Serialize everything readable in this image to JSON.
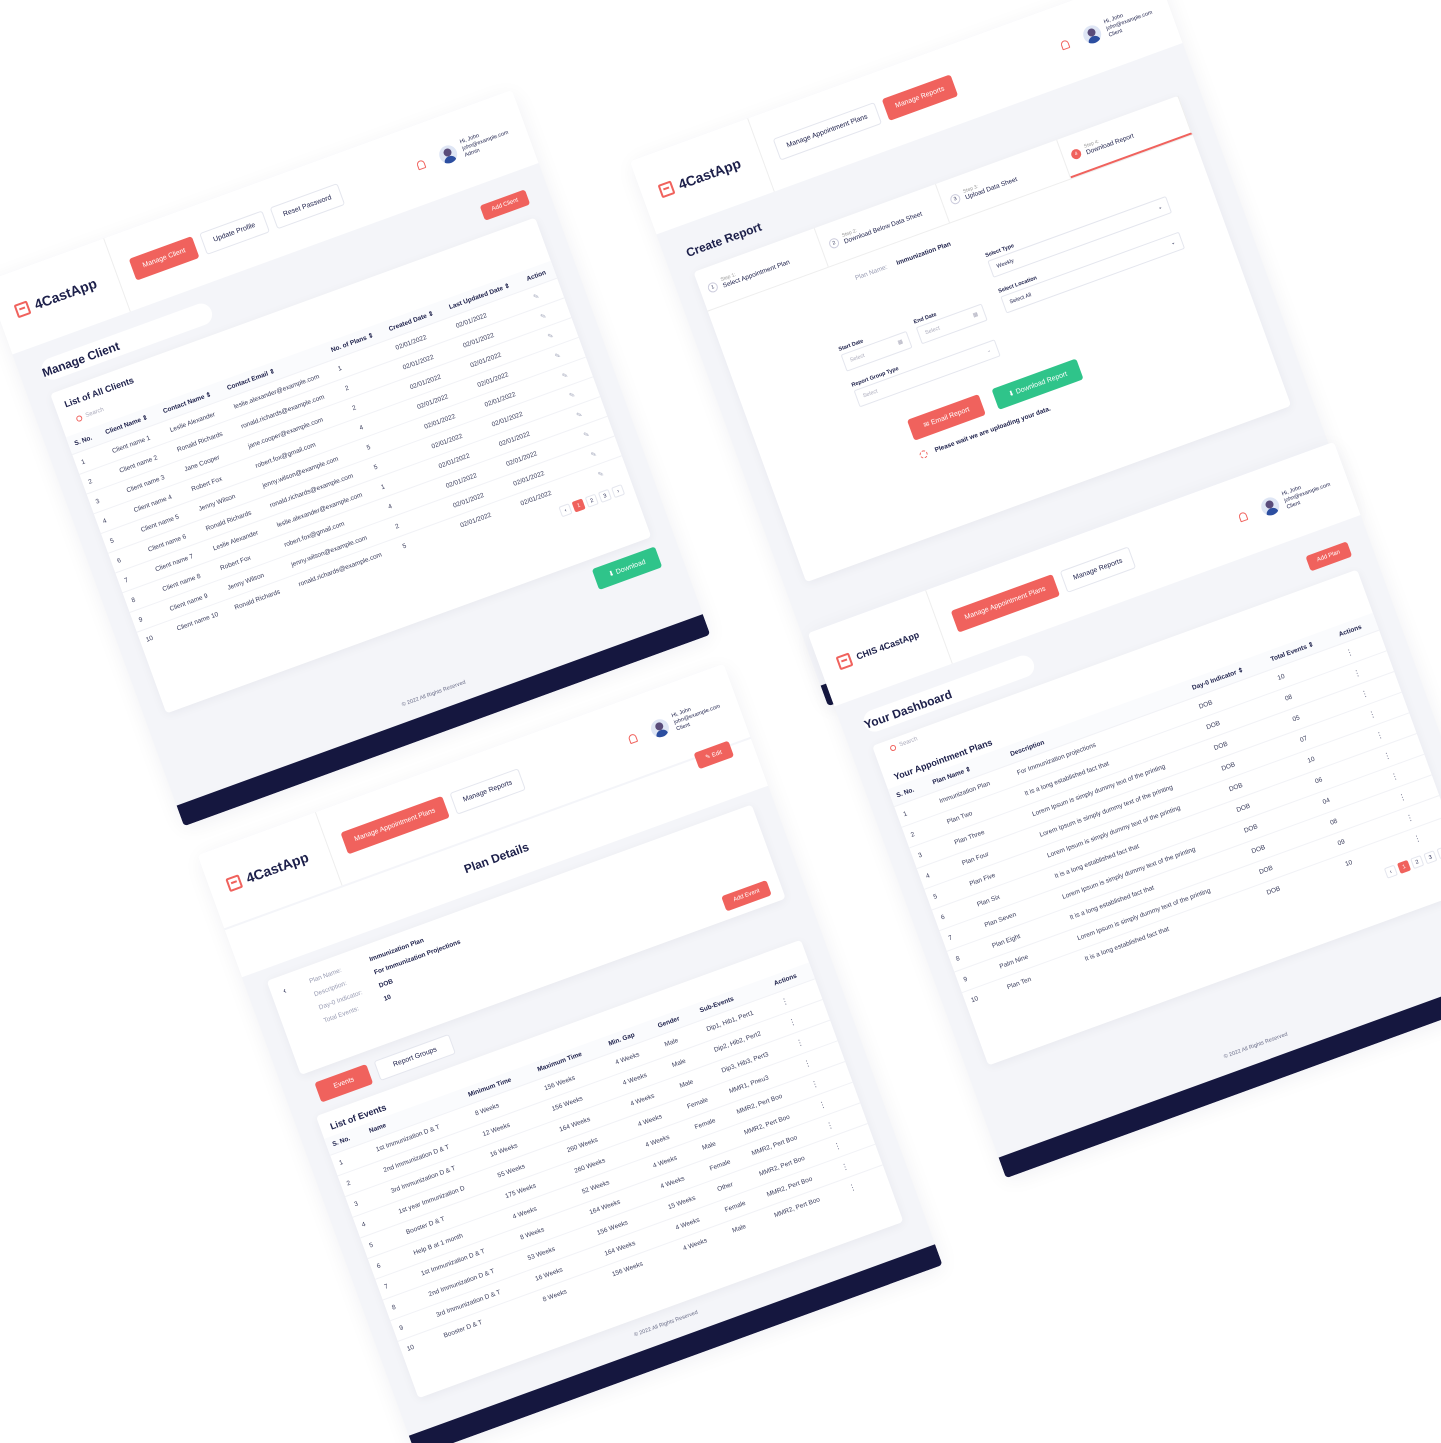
{
  "brand": {
    "name": "4CastApp",
    "alt_name": "CHIS 4CastApp",
    "accent": "#f0625d",
    "green": "#2fc48a",
    "navy": "#15173f"
  },
  "footer": {
    "copyright": "© 2022 All Rights Reserved"
  },
  "manage_client": {
    "nav": [
      "Manage Client",
      "Update Profile",
      "Reset Password"
    ],
    "user": {
      "greeting": "Hi, John",
      "email": "john@example.com",
      "role": "Admin"
    },
    "title": "Manage Client",
    "add_button": "Add Client",
    "card_title": "List of All Clients",
    "search_placeholder": "Search",
    "columns": [
      "S. No.",
      "Client Name ⇕",
      "Contact Name ⇕",
      "Contact Email ⇕",
      "No. of Plans ⇕",
      "Created Date ⇕",
      "Last Updated Date ⇕",
      "Action"
    ],
    "rows": [
      [
        "1",
        "Client name 1",
        "Leslie Alexander",
        "leslie.alexander@example.com",
        "1",
        "02/01/2022",
        "02/01/2022"
      ],
      [
        "2",
        "Client name 2",
        "Ronald Richards",
        "ronald.richards@example.com",
        "2",
        "02/01/2022",
        "02/01/2022"
      ],
      [
        "3",
        "Client name 3",
        "Jane Cooper",
        "jane.cooper@example.com",
        "2",
        "02/01/2022",
        "02/01/2022"
      ],
      [
        "4",
        "Client name 4",
        "Robert Fox",
        "robert.fox@gmail.com",
        "4",
        "02/01/2022",
        "02/01/2022"
      ],
      [
        "5",
        "Client name 5",
        "Jenny Wilson",
        "jenny.wilson@example.com",
        "5",
        "02/01/2022",
        "02/01/2022"
      ],
      [
        "6",
        "Client name 6",
        "Ronald Richards",
        "ronald.richards@example.com",
        "5",
        "02/01/2022",
        "02/01/2022"
      ],
      [
        "7",
        "Client name 7",
        "Leslie Alexander",
        "leslie.alexander@example.com",
        "1",
        "02/01/2022",
        "02/01/2022"
      ],
      [
        "8",
        "Client name 8",
        "Robert Fox",
        "robert.fox@gmail.com",
        "4",
        "02/01/2022",
        "02/01/2022"
      ],
      [
        "9",
        "Client name 9",
        "Jenny Wilson",
        "jenny.wilson@example.com",
        "2",
        "02/01/2022",
        "02/01/2022"
      ],
      [
        "10",
        "Client name 10",
        "Ronald Richards",
        "ronald.richards@example.com",
        "5",
        "02/01/2022",
        "02/01/2022"
      ]
    ],
    "pages": [
      "‹",
      "1",
      "2",
      "3",
      "›"
    ],
    "download_button": "Download"
  },
  "create_report": {
    "nav": [
      "Manage Appointment Plans",
      "Manage Reports"
    ],
    "user": {
      "greeting": "Hi, John",
      "email": "john@example.com",
      "role": "Client"
    },
    "title": "Create Report",
    "steps": [
      {
        "num": "1",
        "small": "Step 1:",
        "label": "Select Appointment Plan"
      },
      {
        "num": "2",
        "small": "Step 2:",
        "label": "Download Below Data Sheet"
      },
      {
        "num": "3",
        "small": "Step 3:",
        "label": "Upload Data Sheet"
      },
      {
        "num": "4",
        "small": "Step 4:",
        "label": "Download Report"
      }
    ],
    "plan_name_label": "Plan Name:",
    "plan_name_value": "Immunization Plan",
    "select_type_label": "Select Type",
    "select_type_value": "Weekly",
    "start_date_label": "Start Date",
    "start_date_placeholder": "Select",
    "end_date_label": "End Date",
    "end_date_placeholder": "Select",
    "location_label": "Select Location",
    "location_value": "Select All",
    "group_label": "Report Group Type",
    "group_placeholder": "Select",
    "email_button": "Email Report",
    "download_button": "Download Report",
    "status": "Please wait we are uploading your data."
  },
  "plan_details": {
    "nav": [
      "Manage Appointment Plans",
      "Manage Reports"
    ],
    "user": {
      "greeting": "Hi, John",
      "email": "john@example.com",
      "role": "Client"
    },
    "title": "Plan Details",
    "edit_button": "Edit",
    "info": [
      {
        "k": "Plan Name:",
        "v": "Immunization Plan"
      },
      {
        "k": "Description:",
        "v": "For Immunization Projections"
      },
      {
        "k": "Day-0 Indicator:",
        "v": "DOB"
      },
      {
        "k": "Total Events:",
        "v": "10"
      }
    ],
    "add_event": "Add Event",
    "tabs": [
      "Events",
      "Report Groups"
    ],
    "list_title": "List of Events",
    "columns": [
      "S. No.",
      "Name",
      "Minimum Time",
      "Maximum Time",
      "Min. Gap",
      "Gender",
      "Sub-Events",
      "Actions"
    ],
    "rows": [
      [
        "1",
        "1st Immunization D & T",
        "8 Weeks",
        "156 Weeks",
        "4 Weeks",
        "Male",
        "Dip1, Hib1, Pert1"
      ],
      [
        "2",
        "2nd Immunization D & T",
        "12 Weeks",
        "156 Weeks",
        "4 Weeks",
        "Male",
        "Dip2, Hib2, Pert2"
      ],
      [
        "3",
        "3rd Immunization D & T",
        "16 Weeks",
        "164 Weeks",
        "4 Weeks",
        "Male",
        "Dip3, Hib3, Pert3"
      ],
      [
        "4",
        "1st year Immunization D",
        "55 Weeks",
        "260 Weeks",
        "4 Weeks",
        "Female",
        "MMR1, Pneu3"
      ],
      [
        "5",
        "Booster D & T",
        "175 Weeks",
        "260 Weeks",
        "4 Weeks",
        "Female",
        "MMR2, Pert Boo"
      ],
      [
        "6",
        "Help B at 1 month",
        "4 Weeks",
        "52 Weeks",
        "4 Weeks",
        "Male",
        "MMR2, Pert Boo"
      ],
      [
        "7",
        "1st Immunization D & T",
        "8 Weeks",
        "164 Weeks",
        "4 Weeks",
        "Female",
        "MMR2, Pert Boo"
      ],
      [
        "8",
        "2nd Immunization D & T",
        "53 Weeks",
        "156 Weeks",
        "15 Weeks",
        "Other",
        "MMR2, Pert Boo"
      ],
      [
        "9",
        "3rd Immunization D & T",
        "16 Weeks",
        "164 Weeks",
        "4 Weeks",
        "Female",
        "MMR2, Pert Boo"
      ],
      [
        "10",
        "Booster D & T",
        "8 Weeks",
        "156 Weeks",
        "4 Weeks",
        "Male",
        "MMR2, Pert Boo"
      ]
    ]
  },
  "dashboard": {
    "nav": [
      "Manage Appointment Plans",
      "Manage Reports"
    ],
    "user": {
      "greeting": "Hi, John",
      "email": "john@example.com",
      "role": "Client"
    },
    "title": "Your Dashboard",
    "add_button": "Add Plan",
    "card_title": "Your Appointment Plans",
    "search_placeholder": "Search",
    "columns": [
      "S. No.",
      "Plan Name ⇕",
      "Description",
      "Day-0 Indicator ⇕",
      "Total Events ⇕",
      "Actions"
    ],
    "rows": [
      [
        "1",
        "Immunization Plan",
        "For Immunization projections",
        "DOB",
        "10"
      ],
      [
        "2",
        "Plan Two",
        "It is a long established fact that",
        "DOB",
        "08"
      ],
      [
        "3",
        "Plan Three",
        "Lorem Ipsum is simply dummy text of the printing",
        "DOB",
        "05"
      ],
      [
        "4",
        "Plan Four",
        "Lorem Ipsum is simply dummy text of the printing",
        "DOB",
        "07"
      ],
      [
        "5",
        "Plan Five",
        "Lorem Ipsum is simply dummy text of the printing",
        "DOB",
        "10"
      ],
      [
        "6",
        "Plan Six",
        "It is a long established fact that",
        "DOB",
        "06"
      ],
      [
        "7",
        "Plan Seven",
        "Lorem Ipsum is simply dummy text of the printing",
        "DOB",
        "04"
      ],
      [
        "8",
        "Plan Eight",
        "It is a long established fact that",
        "DOB",
        "08"
      ],
      [
        "9",
        "Palm Nine",
        "Lorem Ipsum is simply dummy text of the printing",
        "DOB",
        "09"
      ],
      [
        "10",
        "Plan Ten",
        "It is a long established fact that",
        "DOB",
        "10"
      ]
    ],
    "pages": [
      "‹",
      "1",
      "2",
      "3",
      "›"
    ]
  }
}
